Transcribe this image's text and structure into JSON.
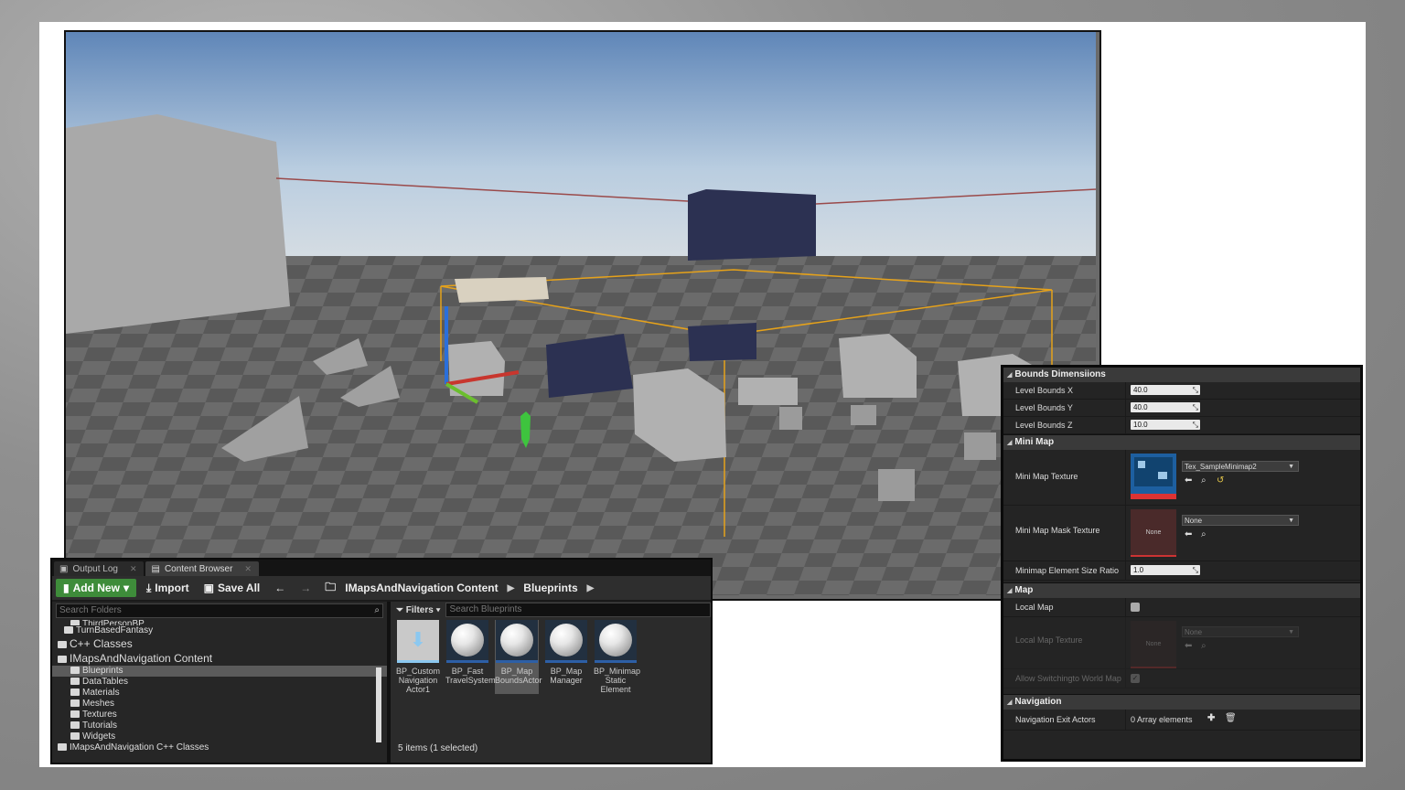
{
  "colors": {
    "add_new_green": "#3e8c3a",
    "selection_grey": "#5b5b5b",
    "bounds_box_orange": "#e6a21a",
    "panel_bg": "#242424"
  },
  "content_browser": {
    "tabs": [
      {
        "label": "Output Log",
        "icon": "output-log-icon"
      },
      {
        "label": "Content Browser",
        "icon": "content-browser-icon"
      }
    ],
    "toolbar": {
      "add_new": "Add New",
      "import": "Import",
      "save_all": "Save All"
    },
    "breadcrumb": [
      "IMapsAndNavigation Content",
      "Blueprints"
    ],
    "folder_search_placeholder": "Search Folders",
    "tree": [
      {
        "label": "ThirdPersonBP",
        "level": 2,
        "big": false,
        "selected": false
      },
      {
        "label": "TurnBasedFantasy",
        "level": 1,
        "big": false,
        "selected": false
      },
      {
        "label": "C++ Classes",
        "level": 0,
        "big": true,
        "selected": false
      },
      {
        "label": "IMapsAndNavigation Content",
        "level": 0,
        "big": true,
        "selected": false
      },
      {
        "label": "Blueprints",
        "level": 2,
        "big": false,
        "selected": true
      },
      {
        "label": "DataTables",
        "level": 2,
        "big": false,
        "selected": false
      },
      {
        "label": "Materials",
        "level": 2,
        "big": false,
        "selected": false
      },
      {
        "label": "Meshes",
        "level": 2,
        "big": false,
        "selected": false
      },
      {
        "label": "Textures",
        "level": 2,
        "big": false,
        "selected": false
      },
      {
        "label": "Tutorials",
        "level": 2,
        "big": false,
        "selected": false
      },
      {
        "label": "Widgets",
        "level": 2,
        "big": false,
        "selected": false
      },
      {
        "label": "IMapsAndNavigation C++ Classes",
        "level": 0,
        "big": false,
        "selected": false
      }
    ],
    "filters_label": "Filters",
    "asset_search_placeholder": "Search Blueprints",
    "assets": [
      {
        "name": "BP_Custom Navigation Actor1",
        "selected": false,
        "thumb": "plain"
      },
      {
        "name": "BP_Fast TravelSystem",
        "selected": false,
        "thumb": "sphere"
      },
      {
        "name": "BP_Map BoundsActor",
        "selected": true,
        "thumb": "sphere"
      },
      {
        "name": "BP_Map Manager",
        "selected": false,
        "thumb": "sphere"
      },
      {
        "name": "BP_Minimap Static Element",
        "selected": false,
        "thumb": "sphere"
      }
    ],
    "status": "5 items (1 selected)"
  },
  "details": {
    "sections": {
      "bounds": "Bounds Dimensiions",
      "minimap": "Mini Map",
      "map": "Map",
      "navigation": "Navigation"
    },
    "bounds": [
      {
        "label": "Level Bounds X",
        "value": "40.0"
      },
      {
        "label": "Level Bounds Y",
        "value": "40.0"
      },
      {
        "label": "Level Bounds Z",
        "value": "10.0"
      }
    ],
    "minimap": {
      "texture_label": "Mini Map Texture",
      "texture_value": "Tex_SampleMinimap2",
      "mask_label": "Mini Map Mask Texture",
      "mask_value": "None",
      "mask_thumb_text": "None",
      "ratio_label": "Minimap Element Size Ratio",
      "ratio_value": "1.0"
    },
    "map": {
      "local_map_label": "Local Map",
      "local_texture_label": "Local Map Texture",
      "local_texture_value": "None",
      "local_thumb_text": "None",
      "allow_switch_label": "Allow Switchingto World Map"
    },
    "navigation": {
      "exit_actors_label": "Navigation Exit Actors",
      "exit_actors_value": "0 Array elements"
    }
  }
}
